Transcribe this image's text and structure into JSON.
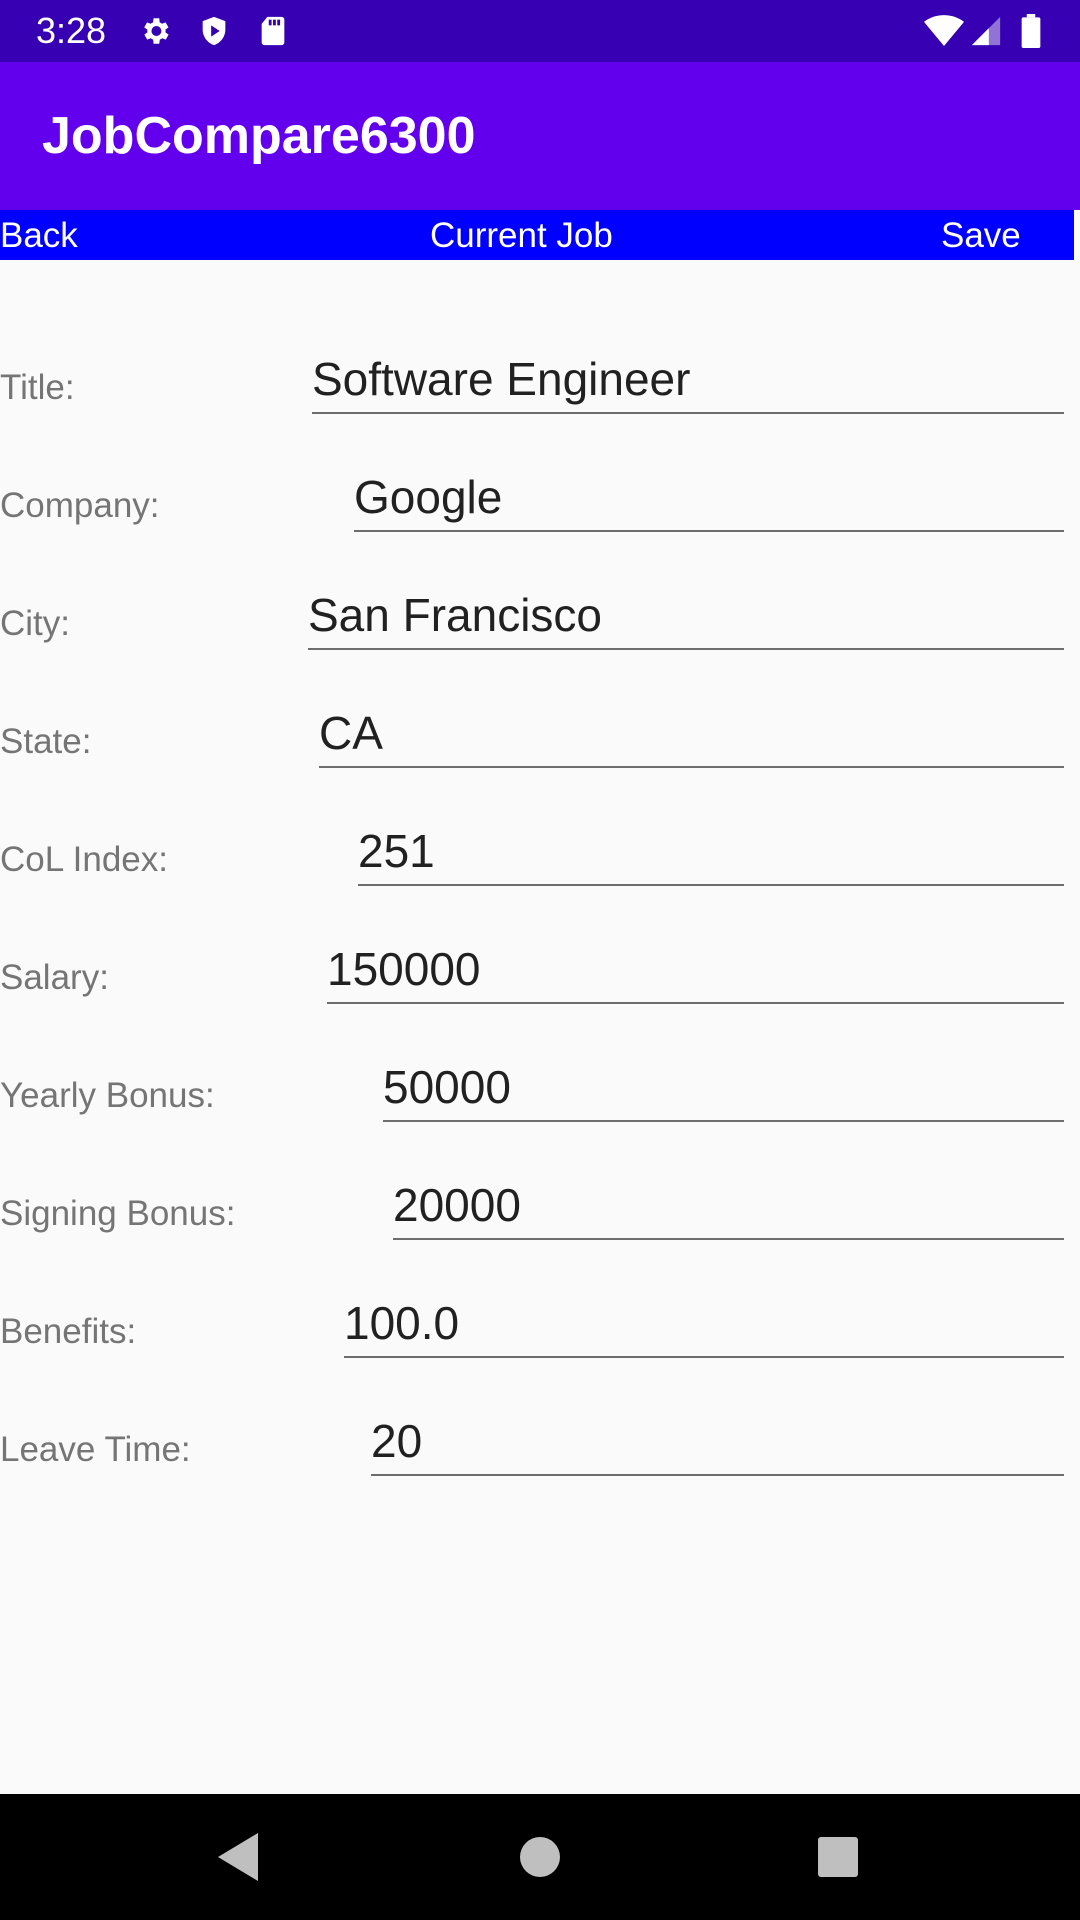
{
  "status_bar": {
    "time": "3:28",
    "icons": [
      "gear-icon",
      "shield-play-icon",
      "sd-card-icon",
      "wifi-icon",
      "signal-icon",
      "battery-icon"
    ]
  },
  "app": {
    "title": "JobCompare6300",
    "colors": {
      "status_bar": "#3700b3",
      "app_bar": "#6200ee",
      "nav_bar": "#0000ff",
      "background": "#fafafa"
    }
  },
  "nav": {
    "back_label": "Back",
    "title": "Current Job",
    "save_label": "Save"
  },
  "fields": {
    "title": {
      "label": "Title:",
      "value": "Software Engineer"
    },
    "company": {
      "label": "Company:",
      "value": "Google"
    },
    "city": {
      "label": "City:",
      "value": "San Francisco"
    },
    "state": {
      "label": "State:",
      "value": "CA"
    },
    "col_index": {
      "label": "CoL Index:",
      "value": "251"
    },
    "salary": {
      "label": "Salary:",
      "value": "150000"
    },
    "yearly_bonus": {
      "label": "Yearly Bonus:",
      "value": "50000"
    },
    "signing_bonus": {
      "label": "Signing Bonus:",
      "value": "20000"
    },
    "benefits": {
      "label": "Benefits:",
      "value": "100.0"
    },
    "leave_time": {
      "label": "Leave Time:",
      "value": "20"
    }
  },
  "system_nav": {
    "icons": [
      "back-triangle-icon",
      "home-circle-icon",
      "recents-square-icon"
    ]
  }
}
